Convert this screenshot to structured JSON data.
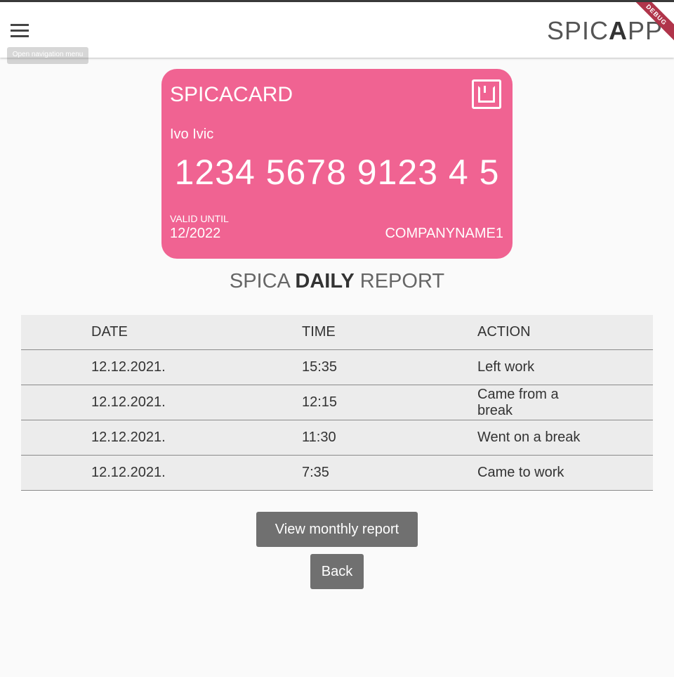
{
  "appbar": {
    "menu_tooltip": "Open navigation menu",
    "brand_part1": "SPIC",
    "brand_bold": "A",
    "brand_part2": "PP",
    "debug_label": "DEBUG"
  },
  "card": {
    "title": "SPICACARD",
    "holder": "Ivo Ivic",
    "number": "1234 5678 9123 4 5",
    "valid_label": "VALID UNTIL",
    "valid_value": "12/2022",
    "company": "COMPANYNAME1",
    "color": "#f06392",
    "icon": "nfc-icon"
  },
  "report": {
    "title_part1": "SPICA ",
    "title_bold": "DAILY",
    "title_part2": " REPORT",
    "headers": [
      "DATE",
      "TIME",
      "ACTION"
    ],
    "rows": [
      {
        "date": "12.12.2021.",
        "time": "15:35",
        "action": "Left work"
      },
      {
        "date": "12.12.2021.",
        "time": "12:15",
        "action": "Came from a break"
      },
      {
        "date": "12.12.2021.",
        "time": "11:30",
        "action": "Went on a break"
      },
      {
        "date": "12.12.2021.",
        "time": "7:35",
        "action": "Came to work"
      }
    ]
  },
  "buttons": {
    "monthly": "View monthly report",
    "back": "Back"
  }
}
